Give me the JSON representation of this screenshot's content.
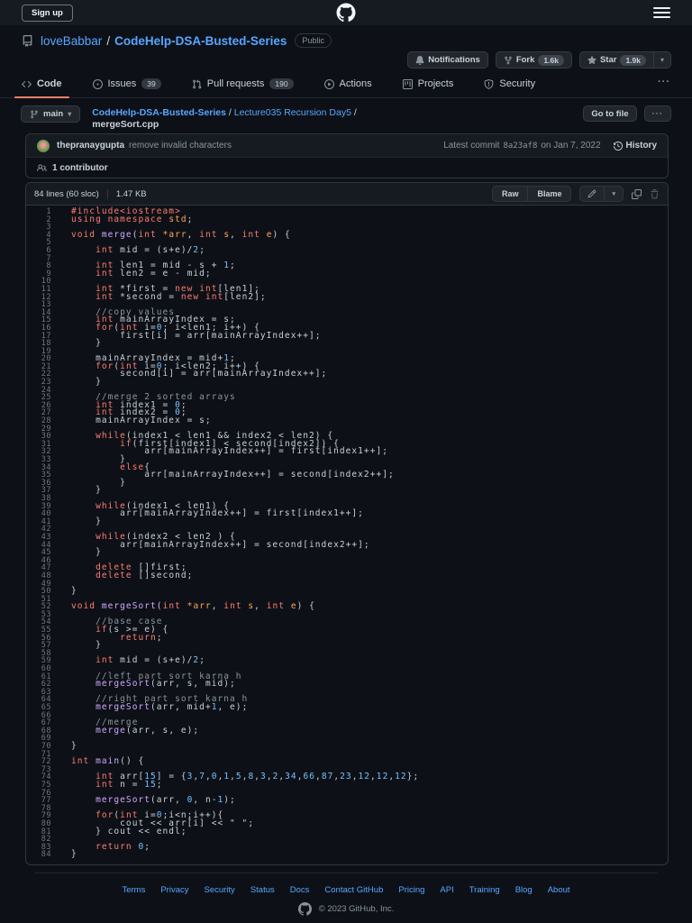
{
  "topbar": {
    "sign_up_label": "Sign up"
  },
  "repo_header": {
    "owner": "loveBabbar",
    "separator": "/",
    "name": "CodeHelp-DSA-Busted-Series",
    "visibility": "Public",
    "notifications_label": "Notifications",
    "fork_label": "Fork",
    "fork_count": "1.6k",
    "star_label": "Star",
    "star_count": "1.9k"
  },
  "tabs": {
    "items": [
      {
        "label": "Code",
        "active": true
      },
      {
        "label": "Issues",
        "badge": "39"
      },
      {
        "label": "Pull requests",
        "badge": "190"
      },
      {
        "label": "Actions"
      },
      {
        "label": "Projects"
      },
      {
        "label": "Security"
      }
    ],
    "overflow": "···"
  },
  "file_nav": {
    "branch": "main",
    "breadcrumb": {
      "repo": "CodeHelp-DSA-Busted-Series",
      "sep1": " / ",
      "dir": "Lecture035 Recursion Day5",
      "sep2": " / ",
      "file": "mergeSort.cpp"
    },
    "go_to_file_label": "Go to file",
    "more_label": "···"
  },
  "commit_bar": {
    "author": "thepranaygupta",
    "message": "remove invalid characters",
    "latest_commit_label": "Latest commit",
    "sha": "8a23af8",
    "date": "on Jan 7, 2022",
    "history_label": "History",
    "contributors": "1 contributor"
  },
  "file_view": {
    "meta": "84 lines (60 sloc)",
    "size": "1.47 KB",
    "raw_label": "Raw",
    "blame_label": "Blame"
  },
  "colors": {
    "link": "#58a6ff",
    "tab_underline": "#f78166",
    "box_border": "#30363d",
    "header_bg": "#161b22",
    "page_bg": "#0d1117"
  },
  "code": {
    "language": "cpp",
    "syntax_colors": {
      "k": "#ff7b72",
      "f": "#d2a8ff",
      "n": "#79c0ff",
      "c": "#8b949e",
      "s": "#a5d6ff",
      "p": "#c9d1d9",
      "o": "#ffa657"
    },
    "lines": [
      [
        [
          "k",
          "#include<iostream>"
        ]
      ],
      [
        [
          "k",
          "using namespace "
        ],
        [
          "o",
          "std"
        ],
        [
          "p",
          ";"
        ]
      ],
      [],
      [
        [
          "k",
          "void"
        ],
        [
          "p",
          " "
        ],
        [
          "f",
          "merge"
        ],
        [
          "p",
          "("
        ],
        [
          "k",
          "int"
        ],
        [
          "p",
          " "
        ],
        [
          "o",
          "*arr"
        ],
        [
          "p",
          ", "
        ],
        [
          "k",
          "int"
        ],
        [
          "p",
          " "
        ],
        [
          "o",
          "s"
        ],
        [
          "p",
          ", "
        ],
        [
          "k",
          "int"
        ],
        [
          "p",
          " "
        ],
        [
          "o",
          "e"
        ],
        [
          "p",
          ") {"
        ]
      ],
      [],
      [
        [
          "p",
          "    "
        ],
        [
          "k",
          "int"
        ],
        [
          "p",
          " mid = (s+e)/"
        ],
        [
          "n",
          "2"
        ],
        [
          "p",
          ";"
        ]
      ],
      [],
      [
        [
          "p",
          "    "
        ],
        [
          "k",
          "int"
        ],
        [
          "p",
          " len1 = mid - s + "
        ],
        [
          "n",
          "1"
        ],
        [
          "p",
          ";"
        ]
      ],
      [
        [
          "p",
          "    "
        ],
        [
          "k",
          "int"
        ],
        [
          "p",
          " len2 = e - mid;"
        ]
      ],
      [],
      [
        [
          "p",
          "    "
        ],
        [
          "k",
          "int"
        ],
        [
          "p",
          " *first = "
        ],
        [
          "k",
          "new"
        ],
        [
          "p",
          " "
        ],
        [
          "k",
          "int"
        ],
        [
          "p",
          "[len1];"
        ]
      ],
      [
        [
          "p",
          "    "
        ],
        [
          "k",
          "int"
        ],
        [
          "p",
          " *second = "
        ],
        [
          "k",
          "new"
        ],
        [
          "p",
          " "
        ],
        [
          "k",
          "int"
        ],
        [
          "p",
          "[len2];"
        ]
      ],
      [],
      [
        [
          "p",
          "    "
        ],
        [
          "c",
          "//copy values"
        ]
      ],
      [
        [
          "p",
          "    "
        ],
        [
          "k",
          "int"
        ],
        [
          "p",
          " mainArrayIndex = s;"
        ]
      ],
      [
        [
          "p",
          "    "
        ],
        [
          "k",
          "for"
        ],
        [
          "p",
          "("
        ],
        [
          "k",
          "int"
        ],
        [
          "p",
          " i="
        ],
        [
          "n",
          "0"
        ],
        [
          "p",
          "; i<len1; i++) {"
        ]
      ],
      [
        [
          "p",
          "        first[i] = arr[mainArrayIndex++];"
        ]
      ],
      [
        [
          "p",
          "    }"
        ]
      ],
      [],
      [
        [
          "p",
          "    mainArrayIndex = mid+"
        ],
        [
          "n",
          "1"
        ],
        [
          "p",
          ";"
        ]
      ],
      [
        [
          "p",
          "    "
        ],
        [
          "k",
          "for"
        ],
        [
          "p",
          "("
        ],
        [
          "k",
          "int"
        ],
        [
          "p",
          " i="
        ],
        [
          "n",
          "0"
        ],
        [
          "p",
          "; i<len2; i++) {"
        ]
      ],
      [
        [
          "p",
          "        second[i] = arr[mainArrayIndex++];"
        ]
      ],
      [
        [
          "p",
          "    }"
        ]
      ],
      [],
      [
        [
          "p",
          "    "
        ],
        [
          "c",
          "//merge 2 sorted arrays"
        ]
      ],
      [
        [
          "p",
          "    "
        ],
        [
          "k",
          "int"
        ],
        [
          "p",
          " index1 = "
        ],
        [
          "n",
          "0"
        ],
        [
          "p",
          ";"
        ]
      ],
      [
        [
          "p",
          "    "
        ],
        [
          "k",
          "int"
        ],
        [
          "p",
          " index2 = "
        ],
        [
          "n",
          "0"
        ],
        [
          "p",
          ";"
        ]
      ],
      [
        [
          "p",
          "    mainArrayIndex = s;"
        ]
      ],
      [],
      [
        [
          "p",
          "    "
        ],
        [
          "k",
          "while"
        ],
        [
          "p",
          "(index1 < len1 && index2 < len2) {"
        ]
      ],
      [
        [
          "p",
          "        "
        ],
        [
          "k",
          "if"
        ],
        [
          "p",
          "(first[index1] < second[index2]) {"
        ]
      ],
      [
        [
          "p",
          "            arr[mainArrayIndex++] = first[index1++];"
        ]
      ],
      [
        [
          "p",
          "        }"
        ]
      ],
      [
        [
          "p",
          "        "
        ],
        [
          "k",
          "else"
        ],
        [
          "p",
          "{"
        ]
      ],
      [
        [
          "p",
          "            arr[mainArrayIndex++] = second[index2++];"
        ]
      ],
      [
        [
          "p",
          "        }"
        ]
      ],
      [
        [
          "p",
          "    }"
        ]
      ],
      [],
      [
        [
          "p",
          "    "
        ],
        [
          "k",
          "while"
        ],
        [
          "p",
          "(index1 < len1) {"
        ]
      ],
      [
        [
          "p",
          "        arr[mainArrayIndex++] = first[index1++];"
        ]
      ],
      [
        [
          "p",
          "    }"
        ]
      ],
      [],
      [
        [
          "p",
          "    "
        ],
        [
          "k",
          "while"
        ],
        [
          "p",
          "(index2 < len2 ) {"
        ]
      ],
      [
        [
          "p",
          "        arr[mainArrayIndex++] = second[index2++];"
        ]
      ],
      [
        [
          "p",
          "    }"
        ]
      ],
      [],
      [
        [
          "p",
          "    "
        ],
        [
          "k",
          "delete"
        ],
        [
          "p",
          " []first;"
        ]
      ],
      [
        [
          "p",
          "    "
        ],
        [
          "k",
          "delete"
        ],
        [
          "p",
          " []second;"
        ]
      ],
      [],
      [
        [
          "p",
          "}"
        ]
      ],
      [],
      [
        [
          "k",
          "void"
        ],
        [
          "p",
          " "
        ],
        [
          "f",
          "mergeSort"
        ],
        [
          "p",
          "("
        ],
        [
          "k",
          "int"
        ],
        [
          "p",
          " "
        ],
        [
          "o",
          "*arr"
        ],
        [
          "p",
          ", "
        ],
        [
          "k",
          "int"
        ],
        [
          "p",
          " "
        ],
        [
          "o",
          "s"
        ],
        [
          "p",
          ", "
        ],
        [
          "k",
          "int"
        ],
        [
          "p",
          " "
        ],
        [
          "o",
          "e"
        ],
        [
          "p",
          ") {"
        ]
      ],
      [],
      [
        [
          "p",
          "    "
        ],
        [
          "c",
          "//base case"
        ]
      ],
      [
        [
          "p",
          "    "
        ],
        [
          "k",
          "if"
        ],
        [
          "p",
          "(s >= e) {"
        ]
      ],
      [
        [
          "p",
          "        "
        ],
        [
          "k",
          "return"
        ],
        [
          "p",
          ";"
        ]
      ],
      [
        [
          "p",
          "    }"
        ]
      ],
      [],
      [
        [
          "p",
          "    "
        ],
        [
          "k",
          "int"
        ],
        [
          "p",
          " mid = (s+e)/"
        ],
        [
          "n",
          "2"
        ],
        [
          "p",
          ";"
        ]
      ],
      [],
      [
        [
          "p",
          "    "
        ],
        [
          "c",
          "//left part sort karna h"
        ]
      ],
      [
        [
          "p",
          "    "
        ],
        [
          "f",
          "mergeSort"
        ],
        [
          "p",
          "(arr, s, mid);"
        ]
      ],
      [],
      [
        [
          "p",
          "    "
        ],
        [
          "c",
          "//right part sort karna h"
        ]
      ],
      [
        [
          "p",
          "    "
        ],
        [
          "f",
          "mergeSort"
        ],
        [
          "p",
          "(arr, mid+"
        ],
        [
          "n",
          "1"
        ],
        [
          "p",
          ", e);"
        ]
      ],
      [],
      [
        [
          "p",
          "    "
        ],
        [
          "c",
          "//merge"
        ]
      ],
      [
        [
          "p",
          "    "
        ],
        [
          "f",
          "merge"
        ],
        [
          "p",
          "(arr, s, e);"
        ]
      ],
      [],
      [
        [
          "p",
          "}"
        ]
      ],
      [],
      [
        [
          "k",
          "int"
        ],
        [
          "p",
          " "
        ],
        [
          "f",
          "main"
        ],
        [
          "p",
          "() {"
        ]
      ],
      [],
      [
        [
          "p",
          "    "
        ],
        [
          "k",
          "int"
        ],
        [
          "p",
          " arr["
        ],
        [
          "n",
          "15"
        ],
        [
          "p",
          "] = {"
        ],
        [
          "n",
          "3"
        ],
        [
          "p",
          ","
        ],
        [
          "n",
          "7"
        ],
        [
          "p",
          ","
        ],
        [
          "n",
          "0"
        ],
        [
          "p",
          ","
        ],
        [
          "n",
          "1"
        ],
        [
          "p",
          ","
        ],
        [
          "n",
          "5"
        ],
        [
          "p",
          ","
        ],
        [
          "n",
          "8"
        ],
        [
          "p",
          ","
        ],
        [
          "n",
          "3"
        ],
        [
          "p",
          ","
        ],
        [
          "n",
          "2"
        ],
        [
          "p",
          ","
        ],
        [
          "n",
          "34"
        ],
        [
          "p",
          ","
        ],
        [
          "n",
          "66"
        ],
        [
          "p",
          ","
        ],
        [
          "n",
          "87"
        ],
        [
          "p",
          ","
        ],
        [
          "n",
          "23"
        ],
        [
          "p",
          ","
        ],
        [
          "n",
          "12"
        ],
        [
          "p",
          ","
        ],
        [
          "n",
          "12"
        ],
        [
          "p",
          ","
        ],
        [
          "n",
          "12"
        ],
        [
          "p",
          "};"
        ]
      ],
      [
        [
          "p",
          "    "
        ],
        [
          "k",
          "int"
        ],
        [
          "p",
          " n = "
        ],
        [
          "n",
          "15"
        ],
        [
          "p",
          ";"
        ]
      ],
      [],
      [
        [
          "p",
          "    "
        ],
        [
          "f",
          "mergeSort"
        ],
        [
          "p",
          "(arr, "
        ],
        [
          "n",
          "0"
        ],
        [
          "p",
          ", n-"
        ],
        [
          "n",
          "1"
        ],
        [
          "p",
          ");"
        ]
      ],
      [],
      [
        [
          "p",
          "    "
        ],
        [
          "k",
          "for"
        ],
        [
          "p",
          "("
        ],
        [
          "k",
          "int"
        ],
        [
          "p",
          " i="
        ],
        [
          "n",
          "0"
        ],
        [
          "p",
          ";i<n;i++){"
        ]
      ],
      [
        [
          "p",
          "        cout << arr[i] << "
        ],
        [
          "s",
          "\" \""
        ],
        [
          "p",
          ";"
        ]
      ],
      [
        [
          "p",
          "    } cout << endl;"
        ]
      ],
      [],
      [
        [
          "p",
          "    "
        ],
        [
          "k",
          "return"
        ],
        [
          "p",
          " "
        ],
        [
          "n",
          "0"
        ],
        [
          "p",
          ";"
        ]
      ],
      [
        [
          "p",
          "}"
        ]
      ]
    ]
  },
  "footer": {
    "links": [
      "Terms",
      "Privacy",
      "Security",
      "Status",
      "Docs",
      "Contact GitHub",
      "Pricing",
      "API",
      "Training",
      "Blog",
      "About"
    ],
    "copyright": "© 2023 GitHub, Inc."
  }
}
